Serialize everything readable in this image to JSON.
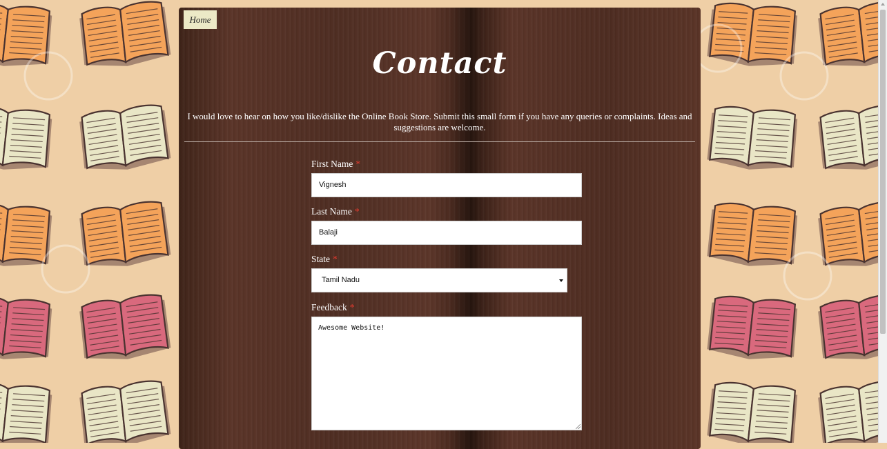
{
  "nav": {
    "home_label": "Home"
  },
  "page": {
    "title": "Contact",
    "intro": "I would love to hear on how you like/dislike the Online Book Store. Submit this small form if you have any queries or complaints. Ideas and suggestions are welcome."
  },
  "form": {
    "required_marker": "*",
    "first_name": {
      "label": "First Name",
      "value": "Vignesh"
    },
    "last_name": {
      "label": "Last Name",
      "value": "Balaji"
    },
    "state": {
      "label": "State",
      "selected": "Tamil Nadu"
    },
    "feedback": {
      "label": "Feedback",
      "value": "Awesome Website!"
    }
  },
  "colors": {
    "background": "#efcfa6",
    "panel": "#4e2d22",
    "home_tab": "#ece9c6",
    "required": "#e03a2e"
  }
}
